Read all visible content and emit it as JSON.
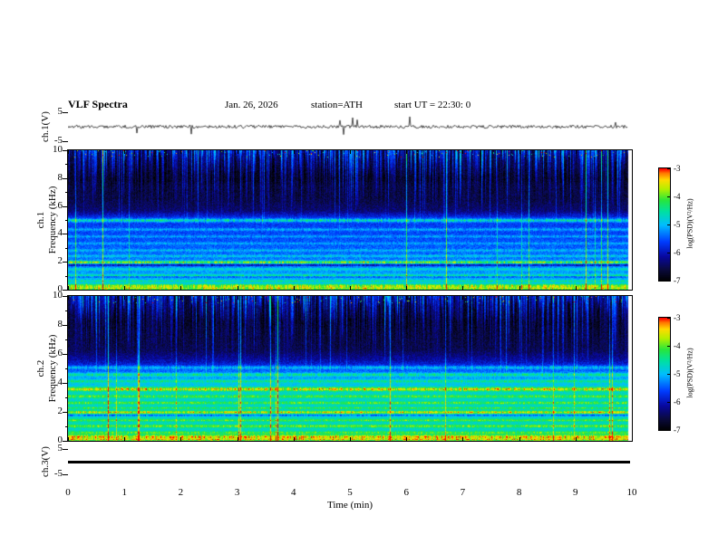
{
  "header": {
    "title": "VLF Spectra",
    "date": "Jan. 26, 2026",
    "station": "station=ATH",
    "start_ut": "start UT =  22:30: 0"
  },
  "axes": {
    "time": {
      "label": "Time  (min)",
      "range": [
        0,
        10
      ],
      "ticks": [
        0,
        1,
        2,
        3,
        4,
        5,
        6,
        7,
        8,
        9,
        10
      ]
    },
    "ch1_volts": {
      "label": "ch.1(V)",
      "range": [
        -5,
        5
      ],
      "ticks": [
        5,
        -5
      ]
    },
    "freq1": {
      "channel": "ch.1",
      "label": "Frequency (kHz)",
      "range": [
        0,
        10
      ],
      "ticks": [
        10,
        8,
        6,
        4,
        2,
        0
      ]
    },
    "freq2": {
      "channel": "ch.2",
      "label": "Frequency (kHz)",
      "range": [
        0,
        10
      ],
      "ticks": [
        10,
        8,
        6,
        4,
        2,
        0
      ]
    },
    "ch3_volts": {
      "label": "ch.3(V)",
      "range": [
        -5,
        5
      ],
      "ticks": [
        5,
        -5
      ]
    }
  },
  "colorbar": {
    "label": "log(PSD)(V²/Hz)",
    "range": [
      -7,
      -3
    ],
    "ticks": [
      -3,
      -4,
      -5,
      -6,
      -7
    ]
  },
  "colormap": {
    "stops": [
      [
        0.0,
        "#000000"
      ],
      [
        0.1,
        "#0a0a3c"
      ],
      [
        0.22,
        "#0808a0"
      ],
      [
        0.35,
        "#003cff"
      ],
      [
        0.5,
        "#00beff"
      ],
      [
        0.62,
        "#00e1a0"
      ],
      [
        0.72,
        "#28e63c"
      ],
      [
        0.82,
        "#b4f000"
      ],
      [
        0.9,
        "#ffdc00"
      ],
      [
        0.96,
        "#ff7800"
      ],
      [
        1.0,
        "#ff0000"
      ]
    ]
  },
  "chart_data": [
    {
      "type": "line",
      "name": "ch1_waveform",
      "ylabel": "ch.1(V)",
      "ylim": [
        -5,
        5
      ],
      "xlim": [
        0,
        10
      ],
      "noise_amplitude_v": 0.5,
      "spike_amplitude_v": 4,
      "description": "broadband receiver output: continuous ~±0.5 V noise with impulsive sferic spikes up to ±4 V"
    },
    {
      "type": "heatmap",
      "name": "ch1_spectrogram",
      "ylabel": "Frequency (kHz)",
      "ylim": [
        0,
        10
      ],
      "xlim": [
        0,
        10
      ],
      "zlabel": "log(PSD)(V²/Hz)",
      "zlim": [
        -7,
        -3
      ],
      "base_profile": [
        [
          0,
          -4.7
        ],
        [
          0.5,
          -5.0
        ],
        [
          1.5,
          -5.2
        ],
        [
          2.5,
          -5.35
        ],
        [
          3.5,
          -5.5
        ],
        [
          4.5,
          -5.6
        ],
        [
          5.2,
          -5.7
        ],
        [
          5.7,
          -6.35
        ],
        [
          6.5,
          -6.55
        ],
        [
          7.5,
          -6.6
        ],
        [
          8.0,
          -6.75
        ],
        [
          9.0,
          -6.6
        ],
        [
          10,
          -6.5
        ]
      ],
      "emission_lines": [
        [
          5.0,
          0.09,
          1.1
        ],
        [
          4.35,
          0.07,
          0.55
        ],
        [
          3.85,
          0.06,
          0.45
        ],
        [
          3.35,
          0.06,
          0.4
        ],
        [
          2.85,
          0.06,
          0.45
        ],
        [
          2.45,
          0.06,
          0.5
        ],
        [
          2.0,
          0.07,
          1.5
        ],
        [
          1.8,
          0.05,
          -0.9
        ],
        [
          1.5,
          0.06,
          0.55
        ],
        [
          1.05,
          0.06,
          0.7
        ],
        [
          0.95,
          0.04,
          -0.6
        ],
        [
          0.65,
          0.06,
          0.6
        ],
        [
          0.3,
          0.1,
          1.2
        ],
        [
          0.12,
          0.06,
          1.0
        ]
      ],
      "sferic_band_khz": [
        5.3,
        10
      ],
      "description": "dark blue background above ~5.5 kHz with dense vertical sferic streaks; layered cyan/green/yellow emission lines below 5.5 kHz"
    },
    {
      "type": "heatmap",
      "name": "ch2_spectrogram",
      "ylabel": "Frequency (kHz)",
      "ylim": [
        0,
        10
      ],
      "xlim": [
        0,
        10
      ],
      "zlabel": "log(PSD)(V²/Hz)",
      "zlim": [
        -7,
        -3
      ],
      "base_profile": [
        [
          0,
          -4.55
        ],
        [
          0.7,
          -4.7
        ],
        [
          1.6,
          -4.7
        ],
        [
          2.6,
          -4.75
        ],
        [
          3.3,
          -4.7
        ],
        [
          4.0,
          -4.9
        ],
        [
          4.8,
          -5.35
        ],
        [
          5.6,
          -6.1
        ],
        [
          6.3,
          -6.5
        ],
        [
          7.5,
          -6.6
        ],
        [
          8.2,
          -6.7
        ],
        [
          9.0,
          -6.6
        ],
        [
          10,
          -6.5
        ]
      ],
      "emission_lines": [
        [
          5.1,
          0.08,
          0.7
        ],
        [
          4.6,
          0.08,
          0.8
        ],
        [
          4.15,
          0.07,
          0.6
        ],
        [
          3.6,
          0.09,
          1.35
        ],
        [
          3.1,
          0.07,
          0.7
        ],
        [
          2.65,
          0.07,
          0.75
        ],
        [
          2.3,
          0.06,
          0.6
        ],
        [
          2.0,
          0.07,
          1.2
        ],
        [
          1.8,
          0.05,
          -0.8
        ],
        [
          1.45,
          0.06,
          0.7
        ],
        [
          1.05,
          0.07,
          0.8
        ],
        [
          0.6,
          0.07,
          0.7
        ],
        [
          0.3,
          0.1,
          1.3
        ],
        [
          0.12,
          0.05,
          1.0
        ]
      ],
      "sferic_band_khz": [
        5.3,
        10
      ],
      "description": "similar sferic streaks above 5.5 kHz; lower half dominated by bright green/yellow emission bands"
    },
    {
      "type": "line",
      "name": "ch3_waveform",
      "ylabel": "ch.3(V)",
      "ylim": [
        -5,
        5
      ],
      "xlim": [
        0,
        10
      ],
      "constant_value_v": 0,
      "description": "flat heavy black line near 0 V (channel inactive)"
    }
  ]
}
